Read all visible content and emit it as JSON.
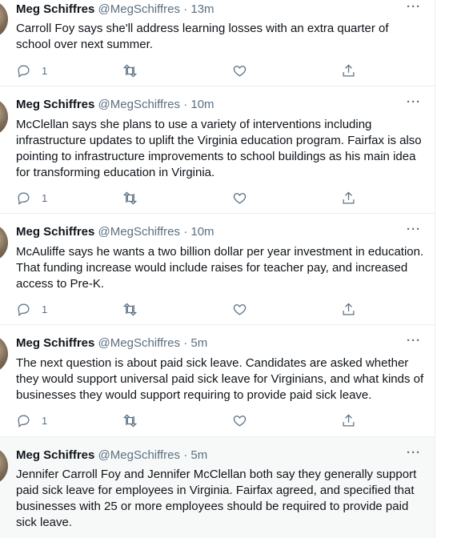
{
  "tweets": [
    {
      "author_name": "Meg Schiffres",
      "author_handle": "@MegSchiffres",
      "separator": "·",
      "timestamp": "13m",
      "more": "···",
      "text": "Carroll Foy says she'll address learning losses with an extra quarter of school over next summer.",
      "reply_count": "1"
    },
    {
      "author_name": "Meg Schiffres",
      "author_handle": "@MegSchiffres",
      "separator": "·",
      "timestamp": "10m",
      "more": "···",
      "text": "McClellan says she plans to use a variety of interventions including infrastructure updates to uplift the Virginia education program. Fairfax is also pointing to infrastructure improvements to school buildings as his main idea for transforming education in Virginia.",
      "reply_count": "1"
    },
    {
      "author_name": "Meg Schiffres",
      "author_handle": "@MegSchiffres",
      "separator": "·",
      "timestamp": "10m",
      "more": "···",
      "text": "McAuliffe says he wants a two billion dollar per year investment in education. That funding increase would include raises for teacher pay, and increased access to Pre-K.",
      "reply_count": "1"
    },
    {
      "author_name": "Meg Schiffres",
      "author_handle": "@MegSchiffres",
      "separator": "·",
      "timestamp": "5m",
      "more": "···",
      "text": "The next question is about paid sick leave. Candidates are asked whether they would support universal paid sick leave for Virginians, and what kinds of businesses they would support requiring to provide paid sick leave.",
      "reply_count": "1"
    },
    {
      "author_name": "Meg Schiffres",
      "author_handle": "@MegSchiffres",
      "separator": "·",
      "timestamp": "5m",
      "more": "···",
      "text": "Jennifer Carroll Foy and Jennifer McClellan both say they generally support paid sick leave for employees in Virginia. Fairfax agreed, and specified that businesses with 25 or more employees should be required to provide paid sick leave."
    }
  ],
  "icons": {
    "reply": "reply-icon",
    "retweet": "retweet-icon",
    "like": "like-icon",
    "share": "share-icon",
    "more": "more-icon"
  },
  "colors": {
    "secondary_text": "#5b7083",
    "primary_text": "#0f1419",
    "divider": "#ebeef0",
    "hover_bg": "#f7f9f9"
  }
}
